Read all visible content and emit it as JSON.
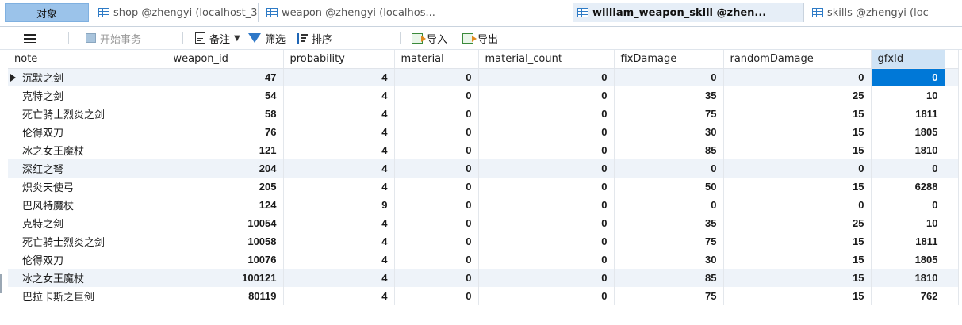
{
  "tabs": {
    "objects_label": "对象",
    "items": [
      {
        "label": "shop @zhengyi (localhost_3..."
      },
      {
        "label": "weapon @zhengyi (localhos..."
      },
      {
        "label": "william_weapon_skill @zhen..."
      },
      {
        "label": "skills @zhengyi (loc"
      }
    ]
  },
  "toolbar": {
    "begin_transaction": "开始事务",
    "memo": "备注",
    "filter": "筛选",
    "sort": "排序",
    "import": "导入",
    "export": "导出"
  },
  "table": {
    "columns": [
      "note",
      "weapon_id",
      "probability",
      "material",
      "material_count",
      "fixDamage",
      "randomDamage",
      "gfxId"
    ],
    "rows": [
      [
        "沉默之剑",
        47,
        4,
        0,
        0,
        0,
        0,
        0
      ],
      [
        "克特之剑",
        54,
        4,
        0,
        0,
        35,
        25,
        10
      ],
      [
        "死亡骑士烈炎之剑",
        58,
        4,
        0,
        0,
        75,
        15,
        1811
      ],
      [
        "伦得双刀",
        76,
        4,
        0,
        0,
        30,
        15,
        1805
      ],
      [
        "冰之女王魔杖",
        121,
        4,
        0,
        0,
        85,
        15,
        1810
      ],
      [
        "深红之弩",
        204,
        4,
        0,
        0,
        0,
        0,
        0
      ],
      [
        "炽炎天使弓",
        205,
        4,
        0,
        0,
        50,
        15,
        6288
      ],
      [
        "巴风特魔杖",
        124,
        9,
        0,
        0,
        0,
        0,
        0
      ],
      [
        "克特之剑",
        10054,
        4,
        0,
        0,
        35,
        25,
        10
      ],
      [
        "死亡骑士烈炎之剑",
        10058,
        4,
        0,
        0,
        75,
        15,
        1811
      ],
      [
        "伦得双刀",
        10076,
        4,
        0,
        0,
        30,
        15,
        1805
      ],
      [
        "冰之女王魔杖",
        100121,
        4,
        0,
        0,
        85,
        15,
        1810
      ],
      [
        "巴拉卡斯之巨剑",
        80119,
        4,
        0,
        0,
        75,
        15,
        762
      ]
    ]
  },
  "colors": {
    "selection": "#0078d7",
    "row_alt": "#eef3f9",
    "objects_tab": "#9bc3ea"
  }
}
